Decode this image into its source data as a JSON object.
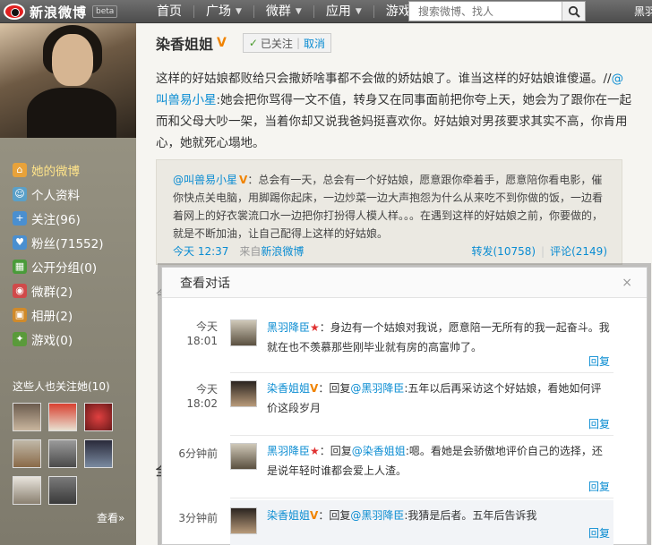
{
  "nav": {
    "logo_text": "新浪微博",
    "beta": "beta",
    "links": [
      {
        "label": "首页",
        "caret": false
      },
      {
        "label": "广场",
        "caret": true
      },
      {
        "label": "微群",
        "caret": true
      },
      {
        "label": "应用",
        "caret": true
      },
      {
        "label": "游戏",
        "caret": true
      }
    ],
    "search_placeholder": "搜索微博、找人",
    "user_partial": "黑羽"
  },
  "sidebar": {
    "items": [
      {
        "label": "她的微博",
        "icon": "home-icon",
        "color": "#e8a23a"
      },
      {
        "label": "个人资料",
        "icon": "profile-icon",
        "color": "#5aa0c8"
      },
      {
        "label": "关注(96)",
        "icon": "follow-icon",
        "color": "#4a8fd0"
      },
      {
        "label": "粉丝(71552)",
        "icon": "fans-icon",
        "color": "#4a8fd0"
      },
      {
        "label": "公开分组(0)",
        "icon": "group-icon",
        "color": "#4a9b3a"
      },
      {
        "label": "微群(2)",
        "icon": "weiqun-icon",
        "color": "#d04a4a"
      },
      {
        "label": "相册(2)",
        "icon": "album-icon",
        "color": "#d08a2a"
      },
      {
        "label": "游戏(0)",
        "icon": "game-icon",
        "color": "#5a9a3a"
      }
    ],
    "follows_title": "这些人也关注她(10)",
    "more": "查看»"
  },
  "main": {
    "user_name": "染香姐姐",
    "v_badge": "V",
    "follow_check": "✓",
    "follow_state": "已关注",
    "unfollow": "取消",
    "post_text_1": "这样的好姑娘都败给只会撒娇啥事都不会做的娇姑娘了。谁当这样的好姑娘谁傻逼。//",
    "post_mention": "@叫兽易小星",
    "post_text_2": ":她会把你骂得一文不值，转身又在同事面前把你夸上天，她会为了跟你在一起而和父母大吵一架，当着你却又说我爸妈挺喜欢你。好姑娘对男孩要求其实不高，你肯用心，她就死心塌地。",
    "quote": {
      "author": "@叫兽易小星",
      "v": "V",
      "text": "：总会有一天，总会有一个好姑娘，愿意跟你牵着手，愿意陪你看电影，催你快点关电脑，用脚踢你起床，一边炒菜一边大声抱怨为什么从来吃不到你做的饭，一边看着网上的好衣裳流口水一边把你打扮得人模人样。。。在遇到这样的好姑娘之前，你要做的，就是不断加油，让自己配得上这样的好姑娘。",
      "time": "今天 12:37",
      "source_prefix": "来自",
      "source": "新浪微博",
      "repost": "转发(10758)",
      "comment": "评论(2149)"
    },
    "stub_label": "今",
    "bottom_label": "全"
  },
  "dialog": {
    "title": "查看对话",
    "close": "×",
    "reply_label": "回复",
    "items": [
      {
        "time_line1": "今天",
        "time_line2": "18:01",
        "name": "黑羽降臣",
        "badge": "★",
        "prefix": "：",
        "mention": "",
        "text": "身边有一个姑娘对我说，愿意陪一无所有的我一起奋斗。我就在也不羡慕那些刚毕业就有房的高富帅了。",
        "highlight": false
      },
      {
        "time_line1": "今天",
        "time_line2": "18:02",
        "name": "染香姐姐",
        "badge": "V",
        "prefix": "：回复",
        "mention": "@黑羽降臣",
        "text": ":五年以后再采访这个好姑娘，看她如何评价这段岁月",
        "highlight": false
      },
      {
        "time_line1": "6分钟前",
        "time_line2": "",
        "name": "黑羽降臣",
        "badge": "★",
        "prefix": "：回复",
        "mention": "@染香姐姐",
        "text": ":嗯。看她是会骄傲地评价自己的选择，还是说年轻时谁都会爱上人渣。",
        "highlight": false
      },
      {
        "time_line1": "3分钟前",
        "time_line2": "",
        "name": "染香姐姐",
        "badge": "V",
        "prefix": "：回复",
        "mention": "@黑羽降臣",
        "text": ":我猜是后者。五年后告诉我",
        "highlight": true
      }
    ]
  },
  "colors": {
    "link": "#0a8cd2",
    "v_badge": "#f08300",
    "nav_bg": "#5a5a5a"
  }
}
